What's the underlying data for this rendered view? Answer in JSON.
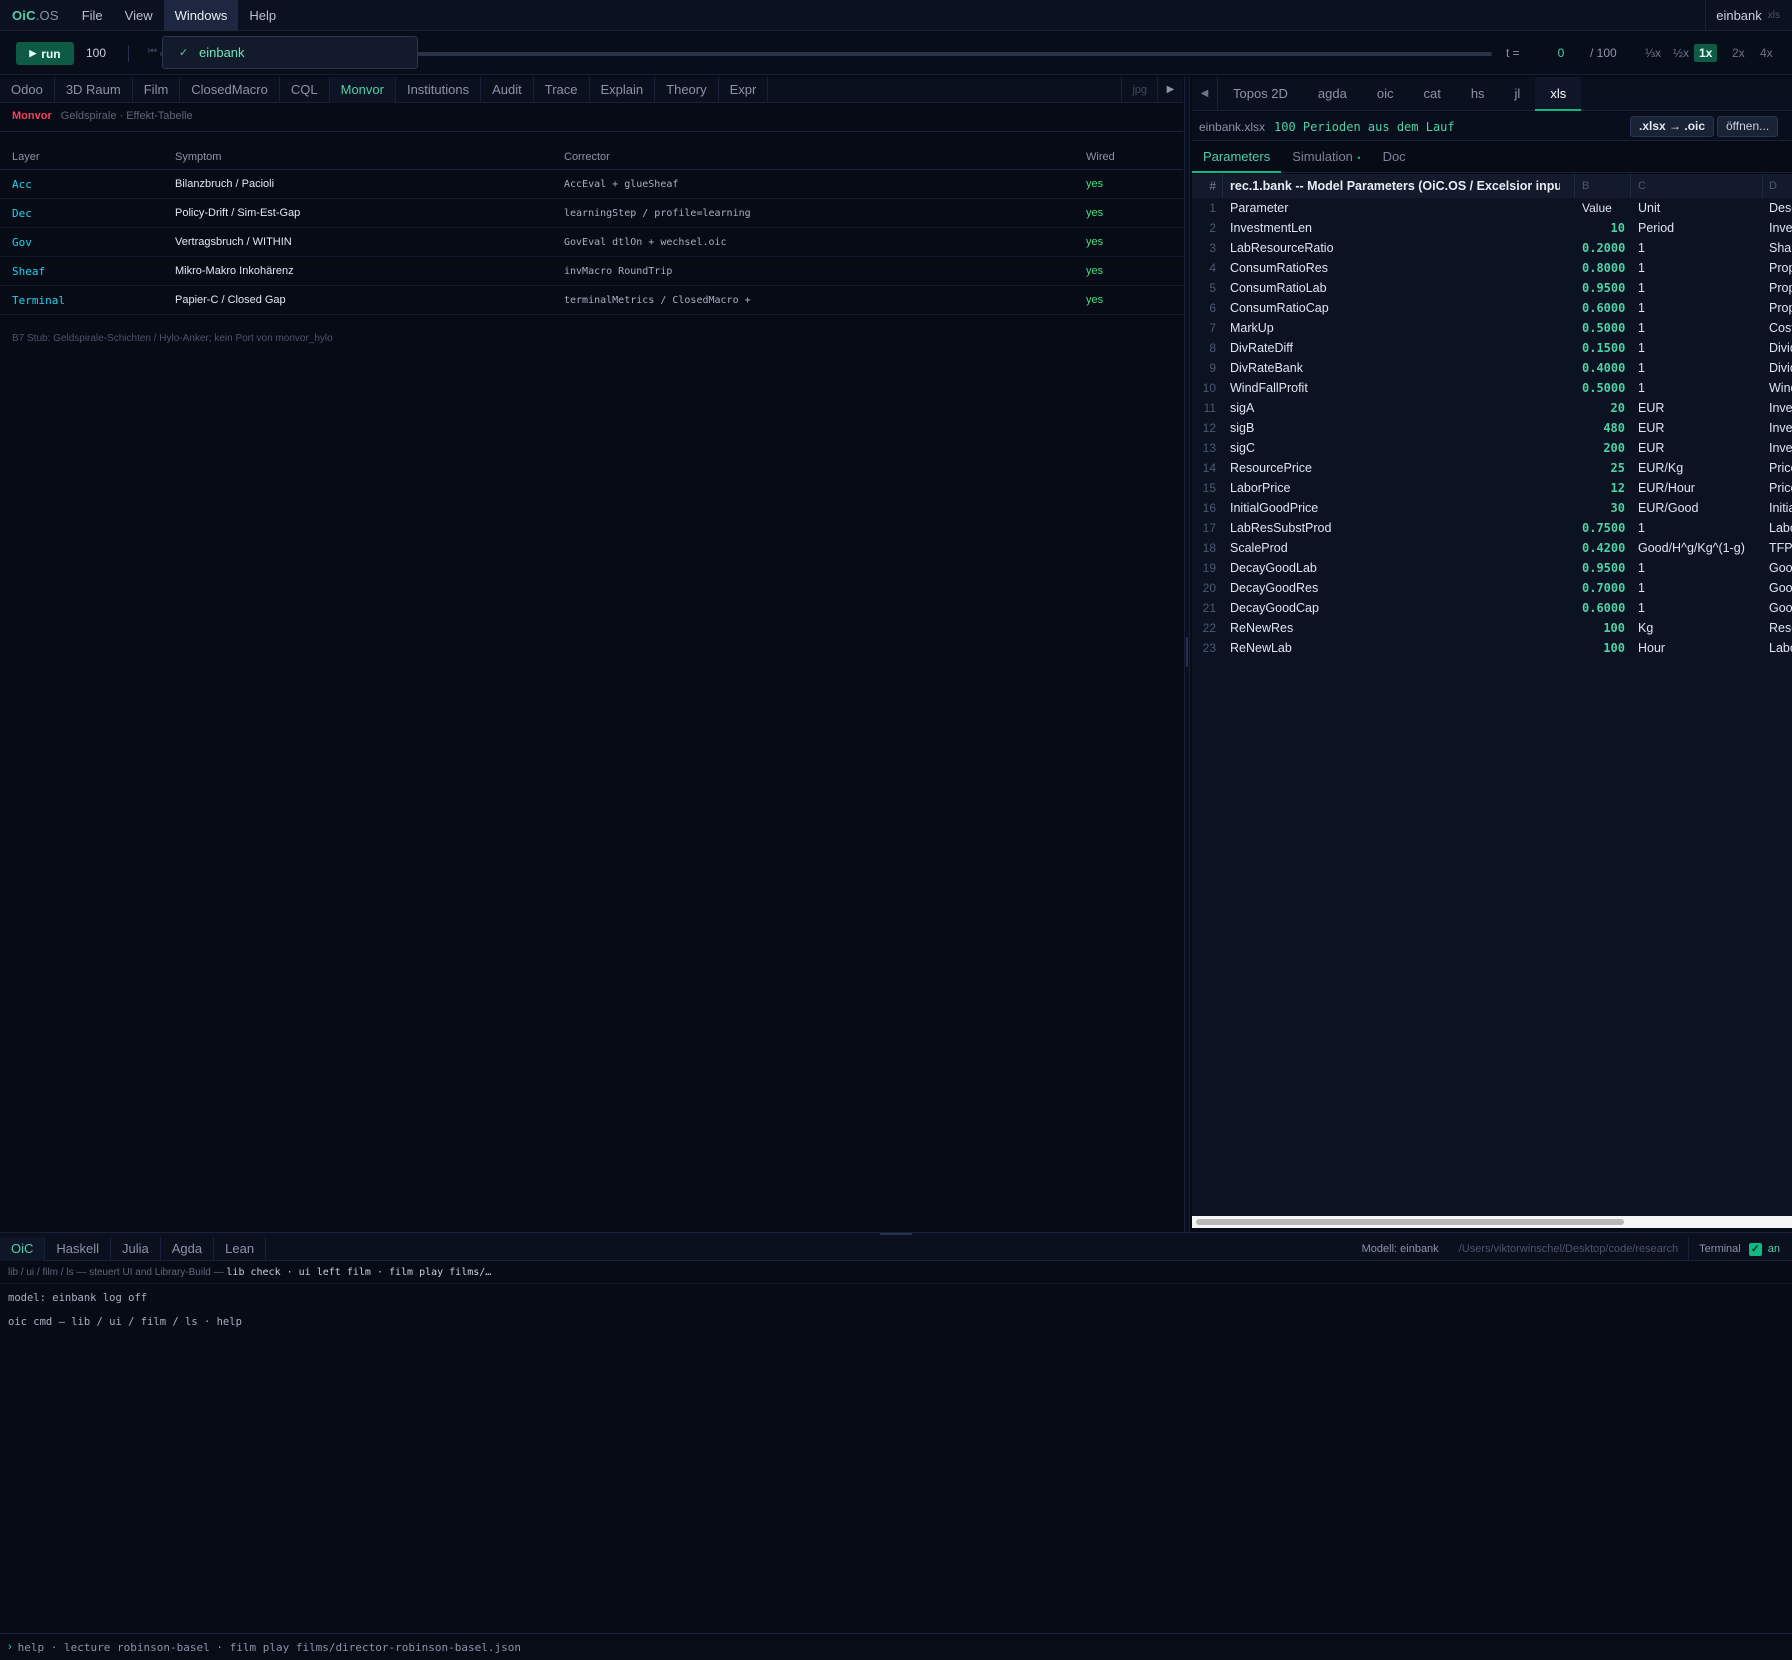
{
  "app": {
    "brand": "OiC",
    "brand_suffix": ".OS",
    "model": "einbank",
    "model_ext": "xls"
  },
  "menubar": [
    "File",
    "View",
    "Windows",
    "Help"
  ],
  "windows_menu": {
    "items": [
      {
        "label": "einbank",
        "checked": true
      }
    ]
  },
  "toolbar": {
    "run_label": "run",
    "run_count": "100",
    "t_label": "t =",
    "t_value": "0",
    "t_total": "/ 100",
    "progress": 0,
    "speeds": [
      "⅓x",
      "½x",
      "1x",
      "2x",
      "4x"
    ],
    "active_speed": "1x"
  },
  "left_tabs": [
    "Odoo",
    "3D Raum",
    "Film",
    "ClosedMacro",
    "CQL",
    "Monvor",
    "Institutions",
    "Audit",
    "Trace",
    "Explain",
    "Theory",
    "Expr"
  ],
  "left_active_tab": "Monvor",
  "left_tabs_extra": {
    "jpg": "jpg"
  },
  "monvor": {
    "title": "Monvor",
    "subtitle": "Geldspirale · Effekt-Tabelle",
    "columns": [
      "Layer",
      "Symptom",
      "Corrector",
      "Wired"
    ],
    "rows": [
      {
        "layer": "Acc",
        "symptom": "Bilanzbruch / Pacioli",
        "corrector": "AccEval + glueSheaf",
        "wired": "yes"
      },
      {
        "layer": "Dec",
        "symptom": "Policy-Drift / Sim-Est-Gap",
        "corrector": "learningStep / profile=learning",
        "wired": "yes"
      },
      {
        "layer": "Gov",
        "symptom": "Vertragsbruch / WITHIN",
        "corrector": "GovEval dtlOn + wechsel.oic",
        "wired": "yes"
      },
      {
        "layer": "Sheaf",
        "symptom": "Mikro-Makro Inkohärenz",
        "corrector": "invMacro RoundTrip",
        "wired": "yes"
      },
      {
        "layer": "Terminal",
        "symptom": "Papier-C / Closed Gap",
        "corrector": "terminalMetrics / ClosedMacro +",
        "wired": "yes"
      }
    ],
    "note": "B7 Stub: Geldspirale-Schichten / Hylo-Anker; kein Port von monvor_hylo"
  },
  "right_tabs": [
    "Topos 2D",
    "agda",
    "oic",
    "cat",
    "hs",
    "jl",
    "xls"
  ],
  "right_active_tab": "xls",
  "file_bar": {
    "name": "einbank.xlsx",
    "info": "100 Perioden aus dem Lauf",
    "convert": ".xlsx → .oic",
    "open": "öffnen..."
  },
  "sheet_tabs": [
    "Parameters",
    "Simulation",
    "Doc"
  ],
  "sheet_active_tab": "Parameters",
  "sheet": {
    "hash": "#",
    "title": "rec.1.bank -- Model Parameters (OiC.OS / Excelsior input)",
    "col_b": "B",
    "col_c": "C",
    "col_d": "D",
    "header_row": {
      "n": "1",
      "param": "Parameter",
      "value": "Value",
      "unit": "Unit",
      "desc": "Desc"
    },
    "rows": [
      {
        "n": "2",
        "param": "InvestmentLen",
        "value": "10",
        "unit": "Period",
        "desc": "Inve"
      },
      {
        "n": "3",
        "param": "LabResourceRatio",
        "value": "0.2000",
        "unit": "1",
        "desc": "Shar"
      },
      {
        "n": "4",
        "param": "ConsumRatioRes",
        "value": "0.8000",
        "unit": "1",
        "desc": "Prop"
      },
      {
        "n": "5",
        "param": "ConsumRatioLab",
        "value": "0.9500",
        "unit": "1",
        "desc": "Prop"
      },
      {
        "n": "6",
        "param": "ConsumRatioCap",
        "value": "0.6000",
        "unit": "1",
        "desc": "Prop"
      },
      {
        "n": "7",
        "param": "MarkUp",
        "value": "0.5000",
        "unit": "1",
        "desc": "Cost"
      },
      {
        "n": "8",
        "param": "DivRateDiff",
        "value": "0.1500",
        "unit": "1",
        "desc": "Divid"
      },
      {
        "n": "9",
        "param": "DivRateBank",
        "value": "0.4000",
        "unit": "1",
        "desc": "Divid"
      },
      {
        "n": "10",
        "param": "WindFallProfit",
        "value": "0.5000",
        "unit": "1",
        "desc": "Wind"
      },
      {
        "n": "11",
        "param": "sigA",
        "value": "20",
        "unit": "EUR",
        "desc": "Inve"
      },
      {
        "n": "12",
        "param": "sigB",
        "value": "480",
        "unit": "EUR",
        "desc": "Inve"
      },
      {
        "n": "13",
        "param": "sigC",
        "value": "200",
        "unit": "EUR",
        "desc": "Inve"
      },
      {
        "n": "14",
        "param": "ResourcePrice",
        "value": "25",
        "unit": "EUR/Kg",
        "desc": "Price"
      },
      {
        "n": "15",
        "param": "LaborPrice",
        "value": "12",
        "unit": "EUR/Hour",
        "desc": "Price"
      },
      {
        "n": "16",
        "param": "InitialGoodPrice",
        "value": "30",
        "unit": "EUR/Good",
        "desc": "Initia"
      },
      {
        "n": "17",
        "param": "LabResSubstProd",
        "value": "0.7500",
        "unit": "1",
        "desc": "Labo"
      },
      {
        "n": "18",
        "param": "ScaleProd",
        "value": "0.4200",
        "unit": "Good/H^g/Kg^(1-g)",
        "desc": "TFP"
      },
      {
        "n": "19",
        "param": "DecayGoodLab",
        "value": "0.9500",
        "unit": "1",
        "desc": "Good"
      },
      {
        "n": "20",
        "param": "DecayGoodRes",
        "value": "0.7000",
        "unit": "1",
        "desc": "Good"
      },
      {
        "n": "21",
        "param": "DecayGoodCap",
        "value": "0.6000",
        "unit": "1",
        "desc": "Good"
      },
      {
        "n": "22",
        "param": "ReNewRes",
        "value": "100",
        "unit": "Kg",
        "desc": "Reso"
      },
      {
        "n": "23",
        "param": "ReNewLab",
        "value": "100",
        "unit": "Hour",
        "desc": "Labo"
      }
    ]
  },
  "console_tabs": [
    "OiC",
    "Haskell",
    "Julia",
    "Agda",
    "Lean"
  ],
  "console_active_tab": "OiC",
  "console_status": {
    "model": "Modell: einbank",
    "path": "/Users/viktorwinschel/Desktop/code/research",
    "terminal": "Terminal",
    "terminal_on": "an"
  },
  "console": {
    "help_prefix": "lib / ui / film / ls — steuert UI and Library-Build —",
    "help_cmds": "lib check · ui left film · film play films/…",
    "model_status": "model: einbank  log off",
    "cmd_help": "oic cmd — lib / ui / film / ls · help"
  },
  "prompt": {
    "hint": "help · lecture robinson-basel · film play films/director-robinson-basel.json"
  },
  "colors": {
    "accent": "#10b981",
    "accent_text": "#4fd1a5",
    "monvor": "#f43f5e",
    "layer": "#22d3ee",
    "bg": "#060b16"
  }
}
